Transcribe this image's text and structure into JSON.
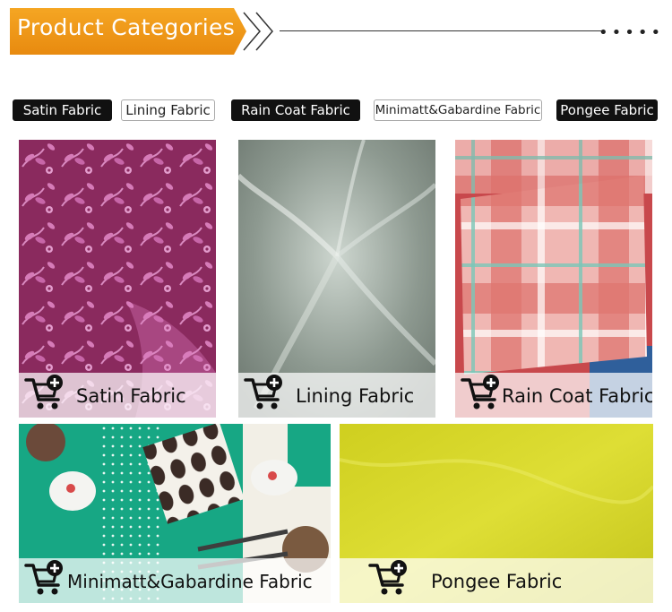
{
  "header": {
    "title": "Product Categories"
  },
  "chips": [
    {
      "label": "Satin Fabric",
      "style": "dark"
    },
    {
      "label": "Lining Fabric",
      "style": "light"
    },
    {
      "label": "Rain Coat Fabric",
      "style": "dark"
    },
    {
      "label": "Minimatt&Gabardine Fabric",
      "style": "light"
    },
    {
      "label": "Pongee Fabric",
      "style": "dark"
    }
  ],
  "tiles": [
    {
      "label": "Satin Fabric",
      "icon": "cart-plus-icon"
    },
    {
      "label": "Lining Fabric",
      "icon": "cart-plus-icon"
    },
    {
      "label": "Rain Coat Fabric",
      "icon": "cart-plus-icon"
    },
    {
      "label": "Minimatt&Gabardine Fabric",
      "icon": "cart-plus-icon"
    },
    {
      "label": "Pongee Fabric",
      "icon": "cart-plus-icon"
    }
  ],
  "colors": {
    "accent": "#f0961a",
    "satin": "#8a2a5e",
    "lining": "#8e9a92",
    "raincoat": "#e8a6a6",
    "minimatt": "#1eaa88",
    "pongee": "#d9d92a"
  }
}
